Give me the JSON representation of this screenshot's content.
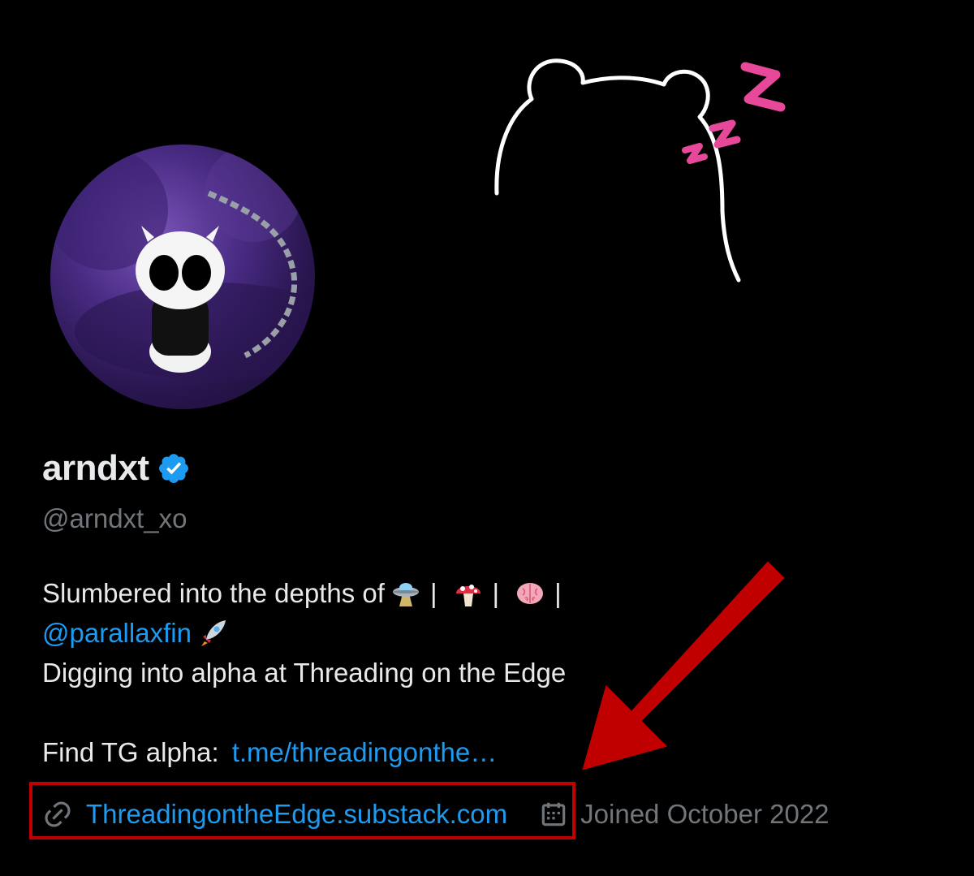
{
  "profile": {
    "display_name": "arndxt",
    "handle": "@arndxt_xo"
  },
  "bio": {
    "line1_text": "Slumbered into the depths of",
    "separator": "|",
    "mention": "@parallaxfin",
    "line3_text": "Digging into alpha at Threading on the Edge",
    "line5_label": "Find TG alpha:",
    "tg_link": "t.me/threadingonthe…"
  },
  "meta": {
    "website": "ThreadingontheEdge.substack.com",
    "joined": "Joined October 2022"
  },
  "icons": {
    "verified": "verified-badge-icon",
    "link": "link-icon",
    "calendar": "calendar-icon",
    "ufo": "ufo-emoji",
    "mushroom": "mushroom-emoji",
    "brain": "brain-emoji",
    "rocket": "rocket-emoji"
  },
  "colors": {
    "background": "#000000",
    "text_primary": "#e7e9ea",
    "text_secondary": "#71767b",
    "accent_link": "#1d9bf0",
    "verified": "#1d9bf0",
    "annotation_red": "#c00000",
    "zzz_pink": "#e8489a"
  }
}
